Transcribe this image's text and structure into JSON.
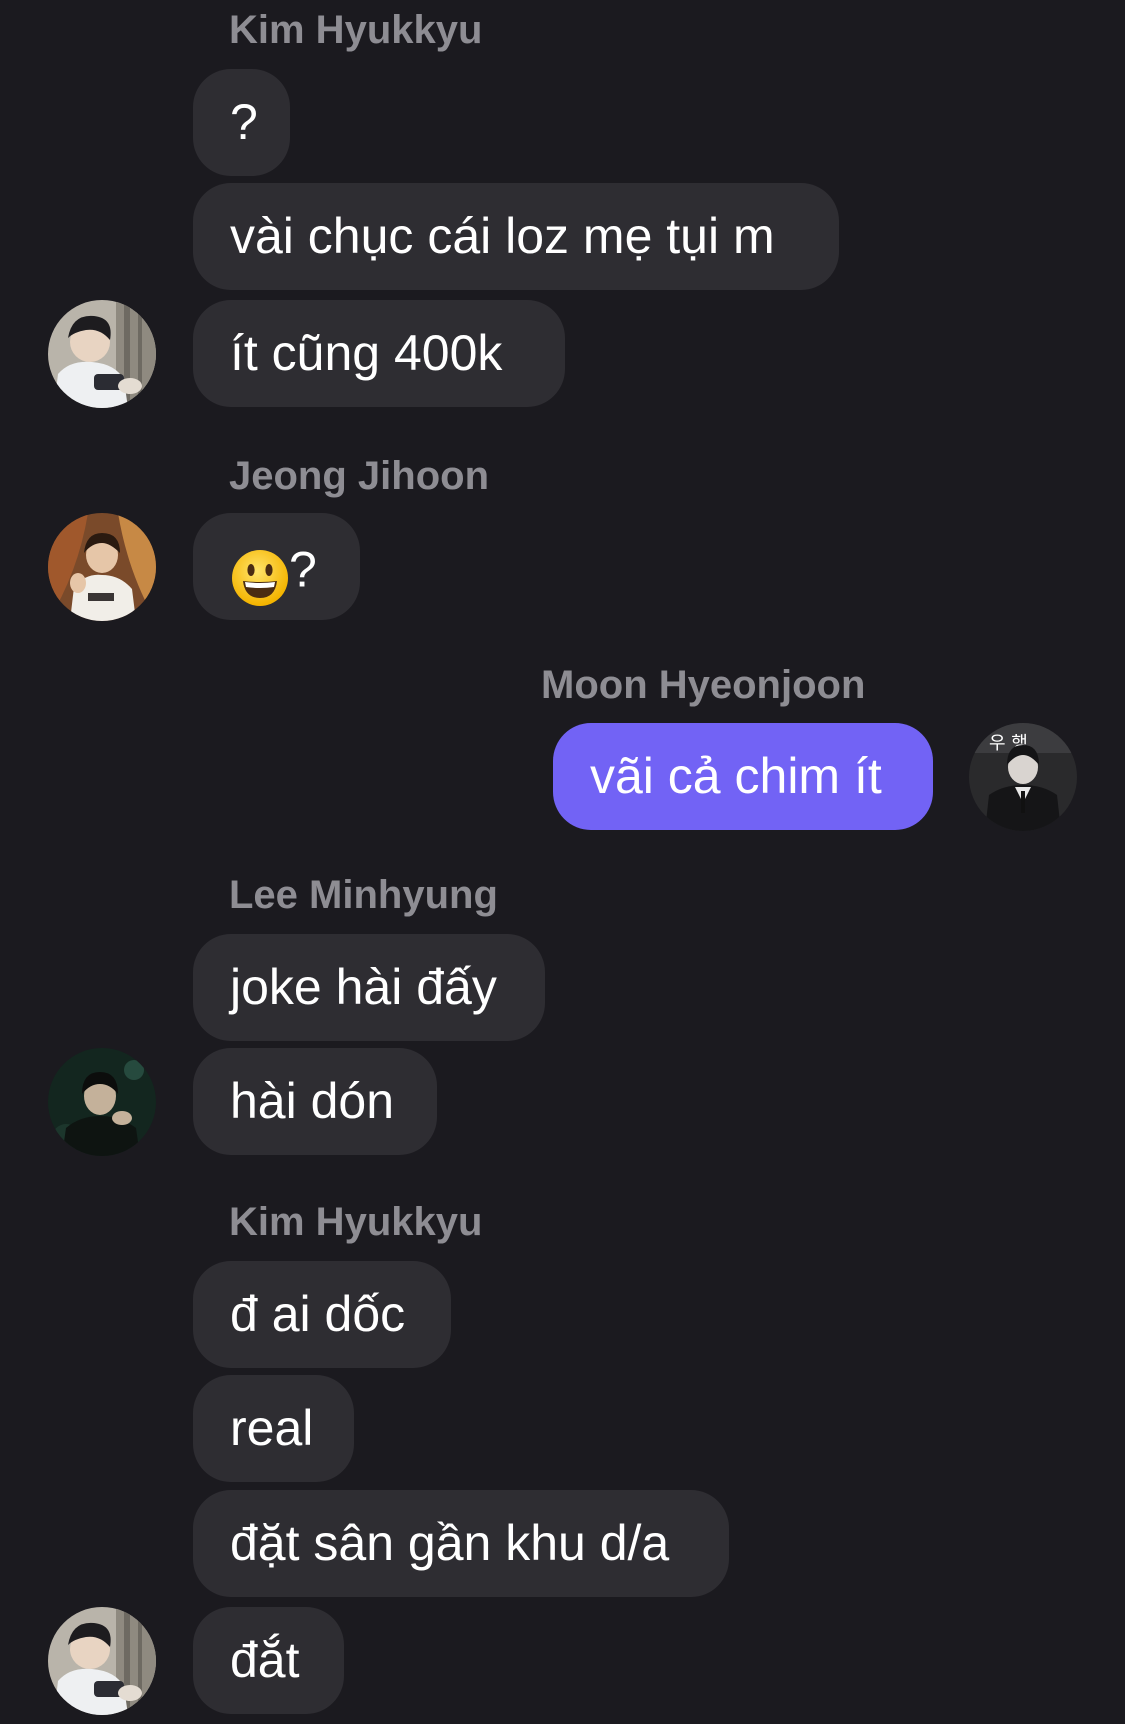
{
  "messages": [
    {
      "sender": "Kim Hyukkyu",
      "bubbles": [
        "?",
        "vài chục cái loz mẹ tụi m",
        "ít cũng 400k"
      ]
    },
    {
      "sender": "Jeong Jihoon",
      "bubbles": [
        "?"
      ],
      "emoji": "grinning-face-emoji"
    },
    {
      "sender": "Moon Hyeonjoon",
      "outgoing": true,
      "bubbles": [
        "vãi cả chim ít"
      ],
      "avatar_text": "우 행"
    },
    {
      "sender": "Lee Minhyung",
      "bubbles": [
        "joke hài đấy",
        "hài dón"
      ]
    },
    {
      "sender": "Kim Hyukkyu",
      "bubbles": [
        "đ ai dốc",
        "real",
        "đặt sân gần khu d/a",
        "đắt"
      ]
    }
  ],
  "colors": {
    "background": "#1b1a1f",
    "incoming_bubble": "#2e2d32",
    "outgoing_bubble": "#7263f5",
    "sender_name": "#8e8d93",
    "text": "#ffffff"
  }
}
